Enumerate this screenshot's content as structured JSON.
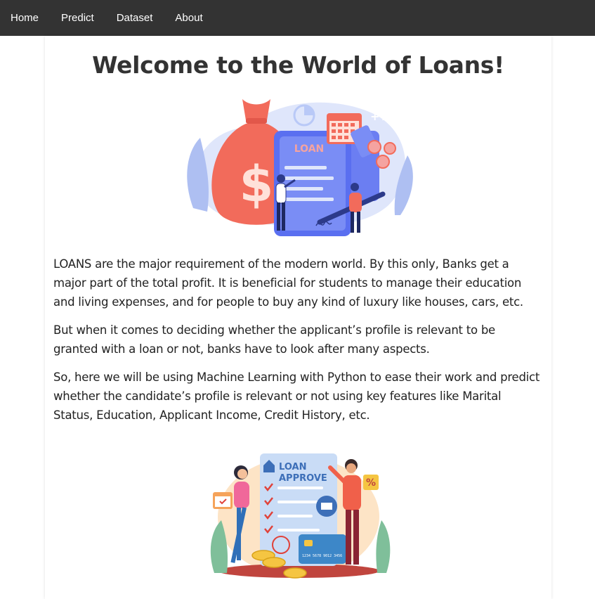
{
  "nav": {
    "items": [
      {
        "label": "Home"
      },
      {
        "label": "Predict"
      },
      {
        "label": "Dataset"
      },
      {
        "label": "About"
      }
    ]
  },
  "main": {
    "title": "Welcome to the World of Loans!",
    "paragraphs": [
      "LOANS are the major requirement of the modern world. By this only, Banks get a major part of the total profit. It is beneficial for students to manage their education and living expenses, and for people to buy any kind of luxury like houses, cars, etc.",
      "But when it comes to deciding whether the applicant’s profile is relevant to be granted with a loan or not, banks have to look after many aspects.",
      "So, here we will be using Machine Learning with Python to ease their work and predict whether the candidate’s profile is relevant or not using key features like Marital Status, Education, Applicant Income, Credit History, etc."
    ]
  },
  "hero_illustration": {
    "document_text": "LOAN",
    "bag_symbol": "$",
    "badge_text": "+%"
  },
  "approve_illustration": {
    "document_text_line1": "LOAN",
    "document_text_line2": "APPROVE",
    "card_number": "1234 5678 9012 3456",
    "badge_text": "%"
  },
  "colors": {
    "navbar": "#333333",
    "coral": "#f26b5b",
    "blue": "#5a6ff0",
    "light_blue": "#b9c9f7"
  }
}
